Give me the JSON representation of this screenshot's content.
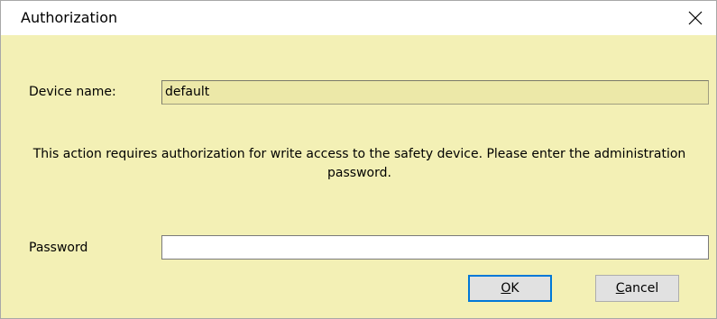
{
  "window": {
    "title": "Authorization",
    "close_icon": "close-icon"
  },
  "device": {
    "label": "Device name:",
    "value": "default"
  },
  "message": {
    "text": "This action requires authorization for write access to the safety device. Please enter the administration password."
  },
  "password": {
    "label": "Password",
    "value": ""
  },
  "buttons": {
    "ok": {
      "mnemonic": "O",
      "rest": "K"
    },
    "cancel": {
      "mnemonic": "C",
      "rest": "ancel"
    }
  },
  "colors": {
    "dialog_background": "#f3f0b5",
    "focus_border": "#0078d7"
  }
}
